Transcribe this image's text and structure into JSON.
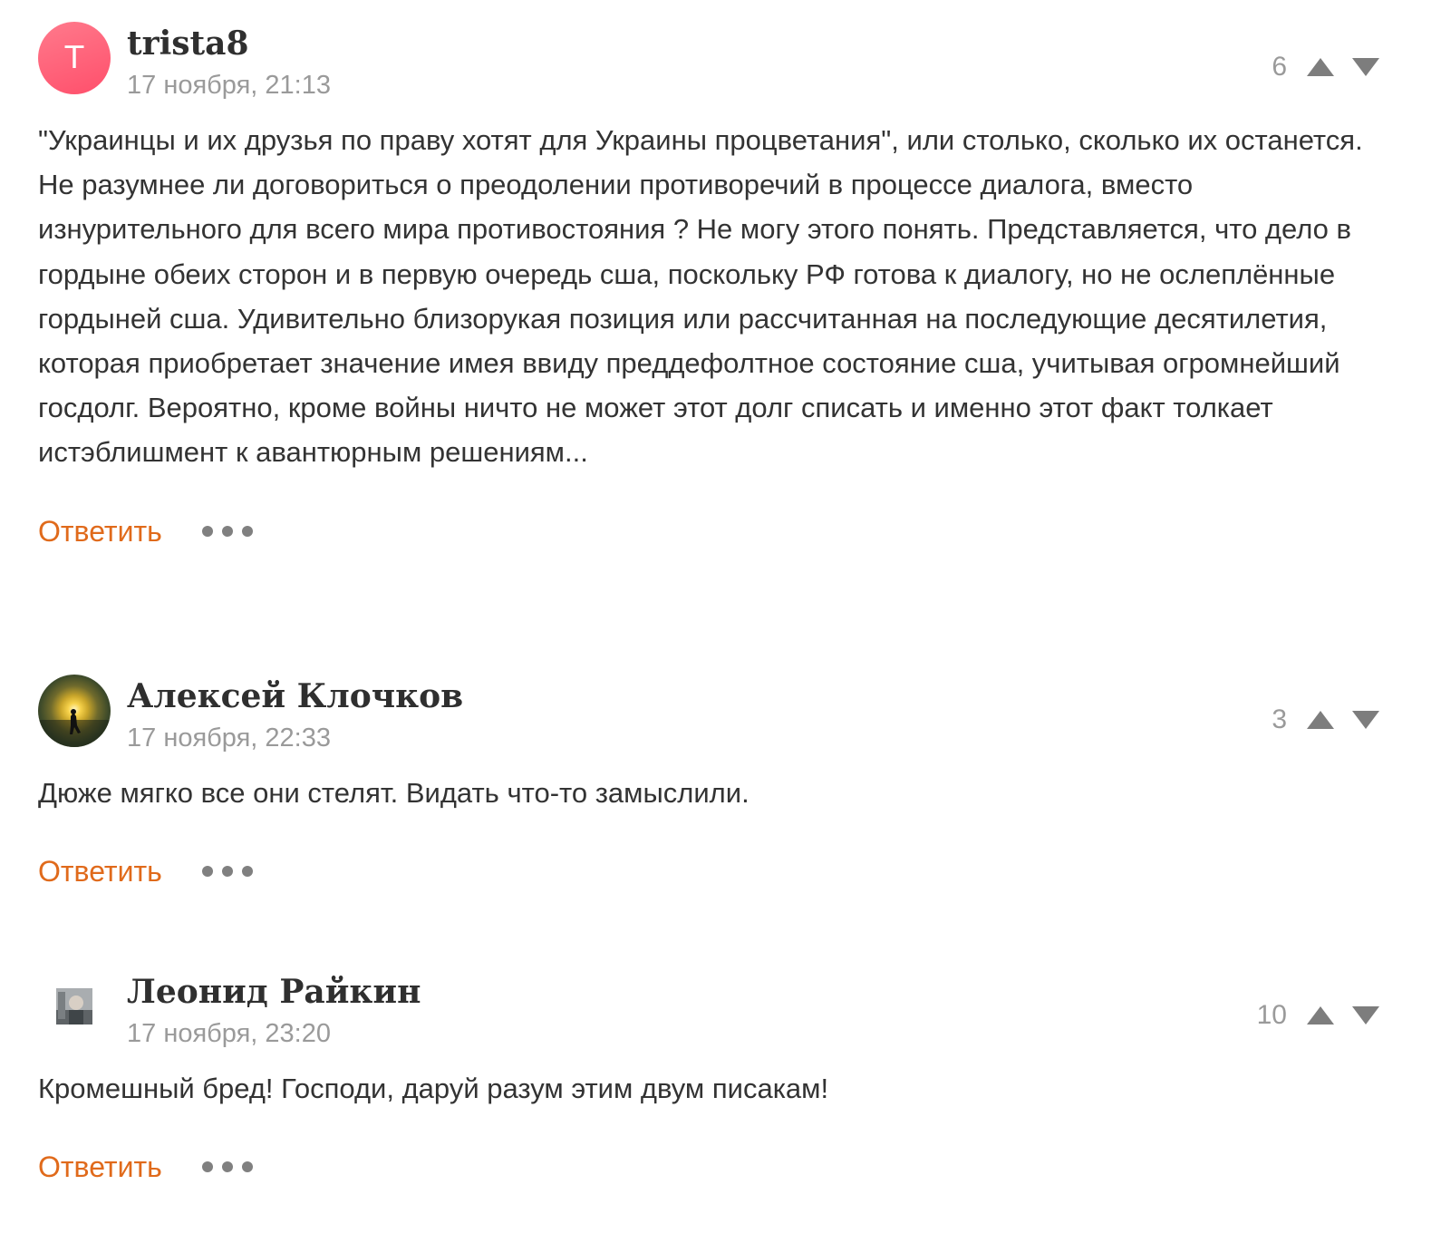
{
  "comments": [
    {
      "author": "trista8",
      "avatar_letter": "T",
      "date": "17 ноября, 21:13",
      "votes": "6",
      "text": "\"Украинцы и их друзья по праву хотят для Украины процветания\", или столько, сколько их останется. Не разумнее ли договориться о преодолении противоречий в процессе диалога, вместо изнурительного для всего мира противостояния ? Не могу этого понять. Представляется, что дело в гордыне обеих сторон и в первую очередь сша, поскольку РФ готова к диалогу, но не ослеплённые гордыней сша. Удивительно близорукая позиция или рассчитанная на последующие десятилетия, которая приобретает значение имея ввиду преддефолтное состояние сша, учитывая огромнейший госдолг. Вероятно, кроме войны ничто не может этот долг списать и именно этот факт толкает истэблишмент к авантюрным решениям...",
      "reply_label": "Ответить"
    },
    {
      "author": "Алексей Клочков",
      "date": "17 ноября, 22:33",
      "votes": "3",
      "text": "Дюже мягко все они стелят. Видать что-то замыслили.",
      "reply_label": "Ответить"
    },
    {
      "author": "Леонид Райкин",
      "date": "17 ноября, 23:20",
      "votes": "10",
      "text": "Кромешный бред! Господи, даруй разум этим двум писакам!",
      "reply_label": "Ответить"
    }
  ],
  "colors": {
    "reply": "#e06a1b",
    "meta": "#9a9a9a",
    "avatar_gradient": "#ff4f6b"
  },
  "icons": {
    "upvote": "triangle-up-icon",
    "downvote": "triangle-down-icon",
    "more": "ellipsis-icon"
  }
}
